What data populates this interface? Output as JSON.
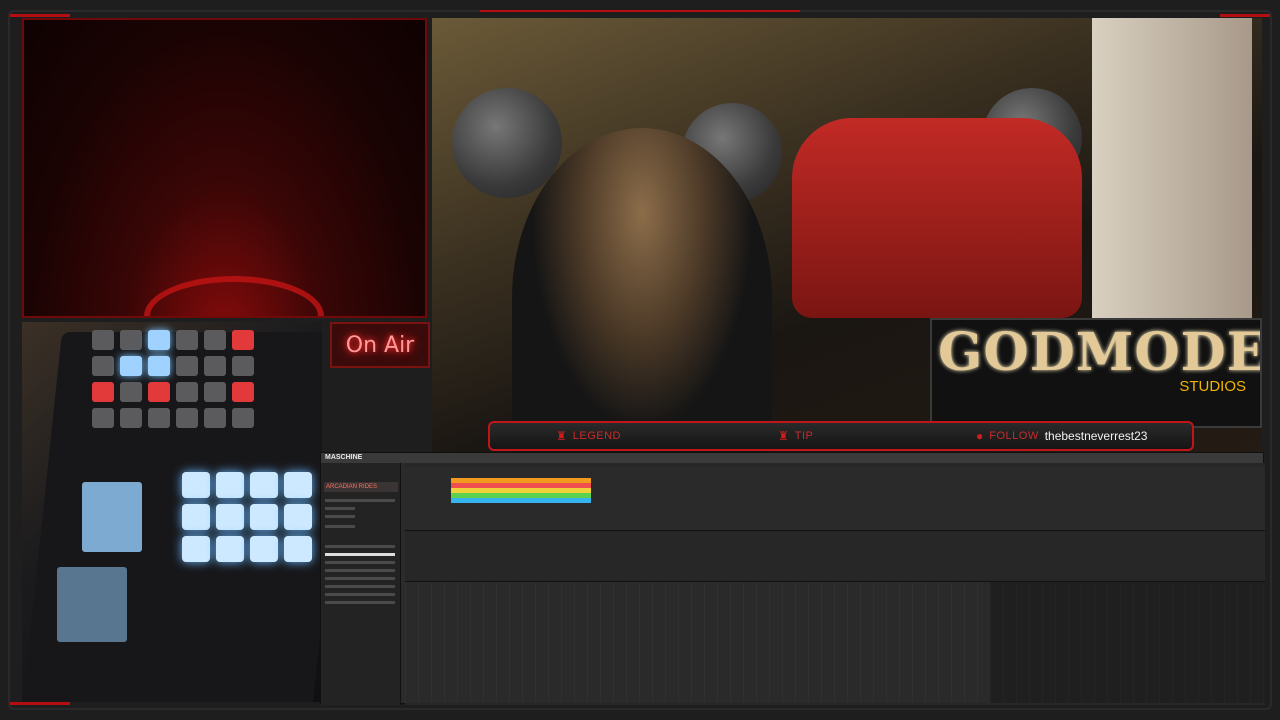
{
  "overlay": {
    "on_air_text": "On Air",
    "logo": {
      "title": "GODMODE",
      "subtitle": "STUDIOS"
    },
    "ticker": {
      "legend_label": "LEGEND",
      "tip_label": "TIP",
      "follow_label": "FOLLOW",
      "follow_value": "thebestneverrest23"
    }
  },
  "daw": {
    "app_name": "MASCHINE",
    "browser_header": "ARCADIAN RIDES",
    "clip_colors": [
      "#f29b1e",
      "#ef4f4f",
      "#f0d23a",
      "#5ed14f",
      "#36b4f0"
    ]
  },
  "colors": {
    "accent_red": "#b30f12",
    "ticker_border": "#c0151a",
    "logo_gold": "#e3c997",
    "studios_yellow": "#f2b400"
  }
}
